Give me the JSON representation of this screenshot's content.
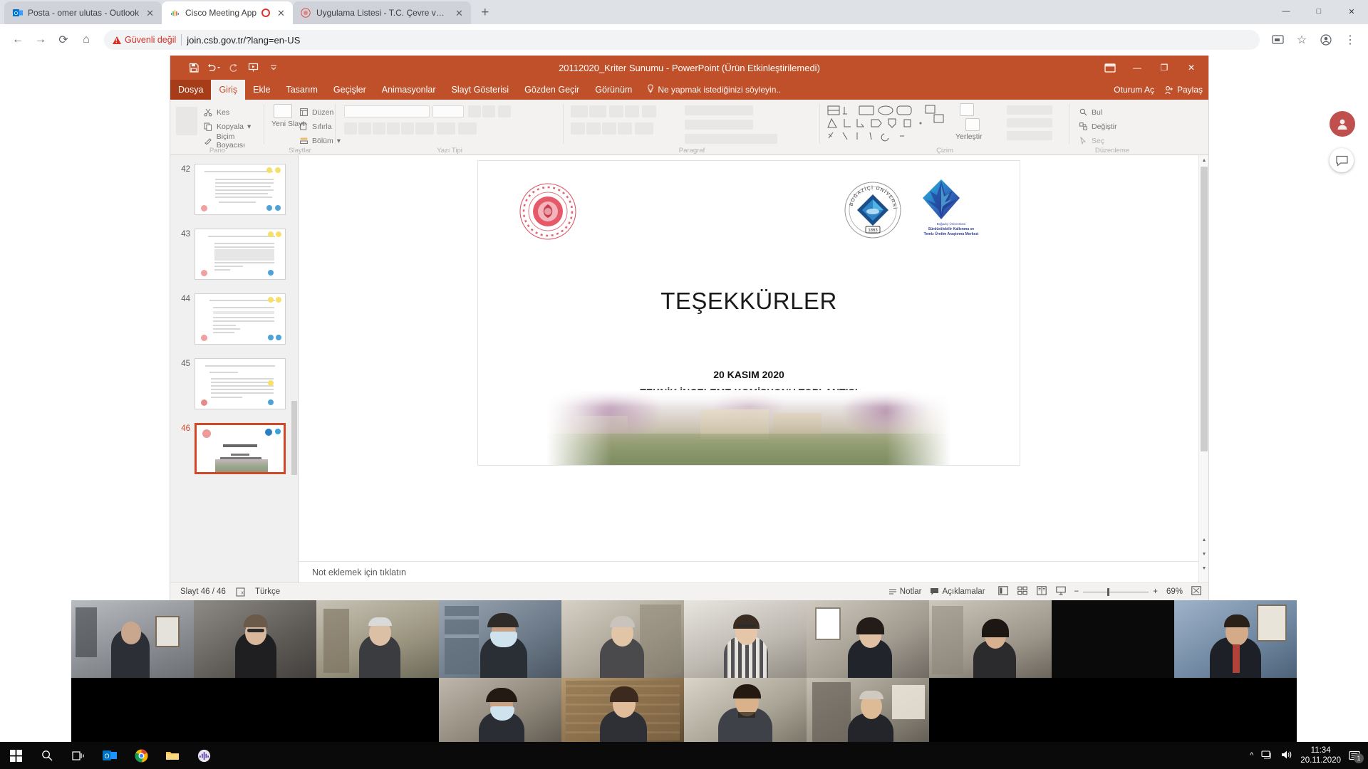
{
  "browser": {
    "tabs": [
      {
        "title": "Posta - omer ulutas - Outlook",
        "icon": "outlook-icon",
        "active": false,
        "recording": false
      },
      {
        "title": "Cisco Meeting App",
        "icon": "cisco-icon",
        "active": true,
        "recording": true
      },
      {
        "title": "Uygulama Listesi - T.C. Çevre ve Ş",
        "icon": "csb-icon",
        "active": false,
        "recording": false
      }
    ],
    "new_tab_label": "+",
    "window_controls": {
      "minimize": "—",
      "maximize": "□",
      "close": "✕"
    },
    "nav": {
      "back": "←",
      "forward": "→",
      "reload": "⟳",
      "home": "⌂"
    },
    "omnibox": {
      "security_label": "Güvenli değil",
      "url": "join.csb.gov.tr/?lang=en-US"
    },
    "toolbar_right": {
      "cast": "cast-icon",
      "bookmark": "☆",
      "profile": "profile-icon",
      "menu": "⋮"
    }
  },
  "powerpoint": {
    "title": "20112020_Kriter Sunumu - PowerPoint (Ürün Etkinleştirilemedi)",
    "quick_access": [
      "save-icon",
      "undo-icon",
      "redo-icon",
      "start-slideshow-icon",
      "customize-qat-icon"
    ],
    "title_buttons": {
      "ribbon_display": "ribbon-display-options",
      "minimize": "—",
      "restore": "❐",
      "close": "✕"
    },
    "tabs": [
      {
        "label": "Dosya",
        "type": "file"
      },
      {
        "label": "Giriş",
        "selected": true
      },
      {
        "label": "Ekle"
      },
      {
        "label": "Tasarım"
      },
      {
        "label": "Geçişler"
      },
      {
        "label": "Animasyonlar"
      },
      {
        "label": "Slayt Gösterisi"
      },
      {
        "label": "Gözden Geçir"
      },
      {
        "label": "Görünüm"
      }
    ],
    "tell_me": "Ne yapmak istediğinizi söyleyin..",
    "sign_in": "Oturum Aç",
    "share": "Paylaş",
    "ribbon": {
      "groups": [
        {
          "label": "Pano",
          "items": [
            "Kes",
            "Kopyala",
            "Biçim Boyacısı"
          ]
        },
        {
          "label": "Slaytlar",
          "items": [
            "Yeni Slayt",
            "Düzen",
            "Sıfırla",
            "Bölüm"
          ]
        },
        {
          "label": "Yazı Tipi",
          "items": []
        },
        {
          "label": "Paragraf",
          "items": []
        },
        {
          "label": "Çizim",
          "items": [
            "Yerleştir"
          ]
        },
        {
          "label": "Düzenleme",
          "items": [
            "Bul",
            "Değiştir",
            "Seç"
          ]
        }
      ]
    },
    "thumbnails": [
      {
        "number": "42",
        "selected": false
      },
      {
        "number": "43",
        "selected": false
      },
      {
        "number": "44",
        "selected": false
      },
      {
        "number": "45",
        "selected": false
      },
      {
        "number": "46",
        "selected": true
      }
    ],
    "slide": {
      "title": "TEŞEKKÜRLER",
      "date": "20 KASIM 2020",
      "subtitle": "TEKNİK İNCELEME KOMİSYONU TOPLANTISI",
      "logos": [
        {
          "name": "tc-cevre-sehircilik-logo",
          "alt": "T.C. Çevre ve Şehircilik Bakanlığı"
        },
        {
          "name": "bogazici-universitesi-logo",
          "alt": "BOĞAZİÇİ ÜNİVERSİTESİ"
        },
        {
          "name": "surdurulebilir-kalkinma-logo",
          "alt": "Sürdürülebilir Kalkınma ve Temiz Üretim Araştırma Merkezi"
        }
      ]
    },
    "notes_placeholder": "Not eklemek için tıklatın",
    "status": {
      "slide_counter": "Slayt 46 / 46",
      "accessibility": "accessibility-icon",
      "language": "Türkçe",
      "notes_button": "Notlar",
      "comments_button": "Açıklamalar",
      "views": [
        "normal-view-icon",
        "slide-sorter-icon",
        "reading-view-icon",
        "slideshow-icon"
      ],
      "zoom_out": "−",
      "zoom_in": "+",
      "zoom_level": "69%",
      "fit_to_window": "fit-to-window-icon"
    }
  },
  "video_grid": {
    "row1_count": 10,
    "row2_count": 4,
    "participants_row1": [
      "participant-1",
      "participant-2",
      "participant-3",
      "participant-4",
      "participant-5",
      "participant-6",
      "participant-7",
      "participant-8",
      "participant-9",
      "participant-10"
    ],
    "participants_row2": [
      "participant-11",
      "participant-12",
      "participant-13",
      "participant-14"
    ]
  },
  "taskbar": {
    "start": "start-icon",
    "search": "search-icon",
    "task_view": "task-view-icon",
    "pinned": [
      "outlook-icon",
      "chrome-icon",
      "explorer-icon",
      "cisco-icon"
    ],
    "tray": {
      "chevron": "^",
      "network": "network-icon",
      "volume": "volume-icon"
    },
    "clock": {
      "time": "11:34",
      "date": "20.11.2020"
    },
    "notifications": {
      "icon": "notification-icon",
      "count": "1"
    }
  },
  "colors": {
    "ppt_orange": "#c0502a",
    "ppt_file_tab": "#a63c18",
    "selection_border": "#d24726",
    "chrome_bg": "#dee1e6",
    "warn_red": "#d93025"
  }
}
